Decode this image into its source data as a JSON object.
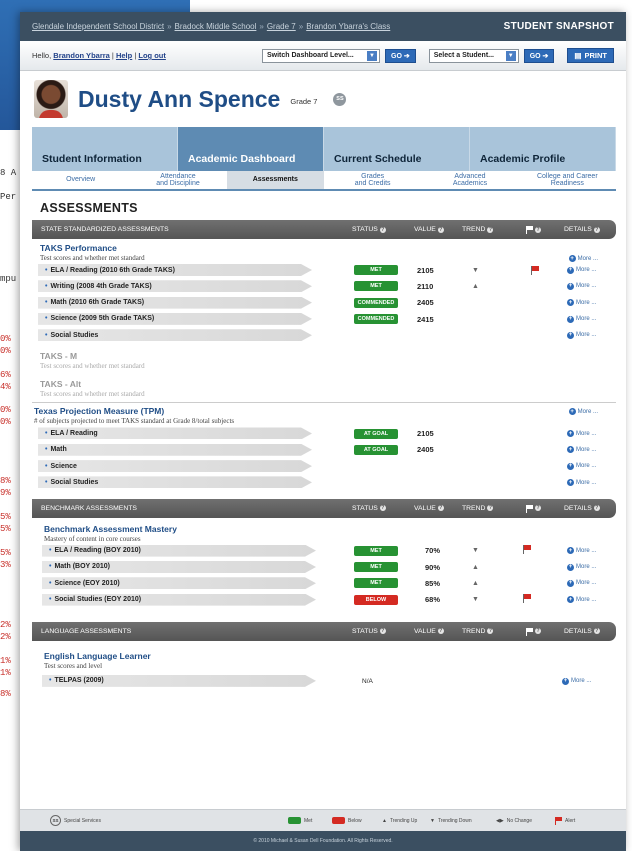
{
  "backdrop": {
    "lines": [
      "8 A",
      "Per",
      "mpu",
      "0%",
      "0%",
      "6%",
      "4%",
      "0%",
      "0%",
      "8%",
      "9%",
      "5%",
      "5%",
      "5%",
      "3%",
      "2%",
      "2%",
      "1%",
      "1%",
      "8%"
    ]
  },
  "header": {
    "breadcrumbs": [
      "Glendale Independent School District",
      "Bradock Middle School",
      "Grade 7",
      "Brandon Ybarra's Class"
    ],
    "breadcrumb_sep": "»",
    "title": "STUDENT SNAPSHOT"
  },
  "userbar": {
    "hello": "Hello,",
    "user": "Brandon Ybarra",
    "sep": "|",
    "help": "Help",
    "logout": "Log out",
    "dashboard_select": "Switch Dashboard Level...",
    "student_select": "Select a Student...",
    "go": "GO ➔",
    "print": "PRINT"
  },
  "student": {
    "name": "Dusty Ann Spence",
    "grade": "Grade 7",
    "badge": "SS"
  },
  "main_tabs": [
    "Student Information",
    "Academic Dashboard",
    "Current Schedule",
    "Academic Profile"
  ],
  "sub_tabs": [
    {
      "l1": "Overview",
      "l2": ""
    },
    {
      "l1": "Attendance",
      "l2": "and Discipline"
    },
    {
      "l1": "Assessments",
      "l2": ""
    },
    {
      "l1": "Grades",
      "l2": "and Credits"
    },
    {
      "l1": "Advanced",
      "l2": "Academics"
    },
    {
      "l1": "College  and Career",
      "l2": "Readiness"
    }
  ],
  "page_title": "ASSESSMENTS",
  "columns": {
    "status": "STATUS",
    "value": "VALUE",
    "trend": "TREND",
    "details": "DETAILS",
    "q": "?"
  },
  "more_label": "More ...",
  "state": {
    "bar": "STATE STANDARDIZED ASSESSMENTS",
    "taks": {
      "title": "TAKS Performance",
      "sub": "Test scores and whether met standard",
      "rows": [
        {
          "name": "ELA / Reading (2010 6th Grade TAKS)",
          "status": "MET",
          "value": "2105",
          "trend": "▼",
          "flag": true
        },
        {
          "name": "Writing (2008 4th Grade TAKS)",
          "status": "MET",
          "value": "2110",
          "trend": "▲",
          "flag": false
        },
        {
          "name": "Math (2010 6th Grade TAKS)",
          "status": "COMMENDED",
          "value": "2405",
          "trend": "",
          "flag": false
        },
        {
          "name": "Science (2009 5th Grade TAKS)",
          "status": "COMMENDED",
          "value": "2415",
          "trend": "",
          "flag": false
        },
        {
          "name": "Social Studies",
          "status": "",
          "value": "",
          "trend": "",
          "flag": false
        }
      ]
    },
    "taks_m": {
      "title": "TAKS - M",
      "sub": "Test scores and whether met standard"
    },
    "taks_alt": {
      "title": "TAKS - Alt",
      "sub": "Test scores and whether met standard"
    },
    "tpm": {
      "title": "Texas Projection Measure (TPM)",
      "sub": "# of subjects projected to meet TAKS standard at Grade 8/total subjects",
      "rows": [
        {
          "name": "ELA / Reading",
          "status": "AT GOAL",
          "value": "2105"
        },
        {
          "name": "Math",
          "status": "AT GOAL",
          "value": "2405"
        },
        {
          "name": "Science",
          "status": "",
          "value": ""
        },
        {
          "name": "Social Studies",
          "status": "",
          "value": ""
        }
      ]
    }
  },
  "benchmark": {
    "bar": "BENCHMARK ASSESSMENTS",
    "title": "Benchmark Assessment Mastery",
    "sub": "Mastery of content in core courses",
    "rows": [
      {
        "name": "ELA / Reading (BOY 2010)",
        "status": "MET",
        "color": "green",
        "value": "70%",
        "trend": "▼",
        "flag": true
      },
      {
        "name": "Math (BOY 2010)",
        "status": "MET",
        "color": "green",
        "value": "90%",
        "trend": "▲",
        "flag": false
      },
      {
        "name": "Science (EOY 2010)",
        "status": "MET",
        "color": "green",
        "value": "85%",
        "trend": "▲",
        "flag": false
      },
      {
        "name": "Social Studies (EOY 2010)",
        "status": "BELOW",
        "color": "red",
        "value": "68%",
        "trend": "▼",
        "flag": true
      }
    ]
  },
  "language": {
    "bar": "LANGUAGE ASSESSMENTS",
    "title": "English Language Learner",
    "sub": "Test scores and level",
    "rows": [
      {
        "name": "TELPAS (2009)",
        "value": "N/A"
      }
    ]
  },
  "legend": {
    "ss": "SS",
    "special": "Special Services",
    "met": "Met",
    "below": "Below",
    "up": "Trending Up",
    "down": "Trending Down",
    "nochange": "No Change",
    "alert": "Alert"
  },
  "copyright": "© 2010 Michael & Susan Dell Foundation. All Rights Reserved.",
  "colors": {
    "green": "#279233",
    "red": "#d42a22",
    "navy": "#3b4f61",
    "blue": "#2d6ab7"
  }
}
